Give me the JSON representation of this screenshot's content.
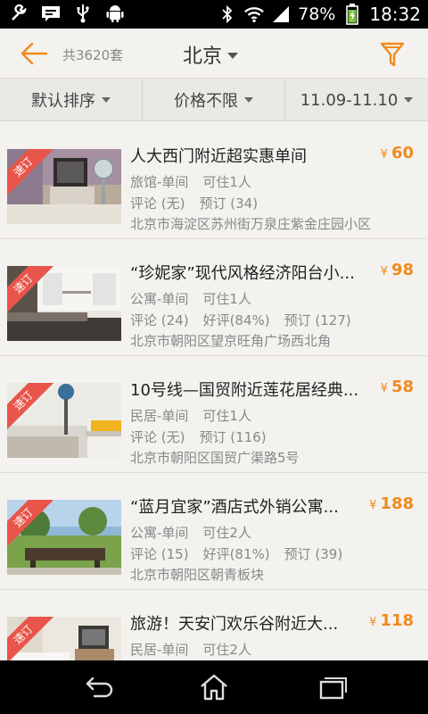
{
  "status_bar": {
    "battery": "78%",
    "time": "18:32",
    "icons": [
      "wrench-icon",
      "message-icon",
      "usb-icon",
      "android-icon",
      "bluetooth-icon",
      "wifi-icon",
      "signal-icon",
      "battery-icon"
    ]
  },
  "header": {
    "count": "共3620套",
    "city": "北京",
    "icons": [
      "back-arrow-icon",
      "filter-icon"
    ]
  },
  "filters": {
    "sort": "默认排序",
    "price": "价格不限",
    "dates": "11.09-11.10"
  },
  "badge_label": "速订",
  "listings": [
    {
      "title": "人大西门附近超实惠单间",
      "price": "60",
      "currency": "¥",
      "type": "旅馆-单间",
      "capacity": "可住1人",
      "reviews": "评论 (无)",
      "rating": "",
      "bookings": "预订 (34)",
      "address": "北京市海淀区苏州街万泉庄紫金庄园小区"
    },
    {
      "title": "“珍妮家”现代风格经济阳台小...",
      "price": "98",
      "currency": "¥",
      "type": "公寓-单间",
      "capacity": "可住1人",
      "reviews": "评论 (24)",
      "rating": "好评(84%)",
      "bookings": "预订 (127)",
      "address": "北京市朝阳区望京旺角广场西北角"
    },
    {
      "title": "10号线—国贸附近莲花居经典...",
      "price": "58",
      "currency": "¥",
      "type": "民居-单间",
      "capacity": "可住1人",
      "reviews": "评论 (无)",
      "rating": "",
      "bookings": "预订 (116)",
      "address": "北京市朝阳区国贸广渠路5号"
    },
    {
      "title": "“蓝月宜家”酒店式外销公寓...",
      "price": "188",
      "currency": "¥",
      "type": "公寓-单间",
      "capacity": "可住2人",
      "reviews": "评论 (15)",
      "rating": "好评(81%)",
      "bookings": "预订 (39)",
      "address": "北京市朝阳区朝青板块"
    },
    {
      "title": "旅游！天安门欢乐谷附近大...",
      "price": "118",
      "currency": "¥",
      "type": "民居-单间",
      "capacity": "可住2人",
      "reviews": "",
      "rating": "",
      "bookings": "",
      "address": ""
    }
  ],
  "nav_bar": {
    "icons": [
      "back-icon",
      "home-icon",
      "recent-apps-icon"
    ]
  }
}
